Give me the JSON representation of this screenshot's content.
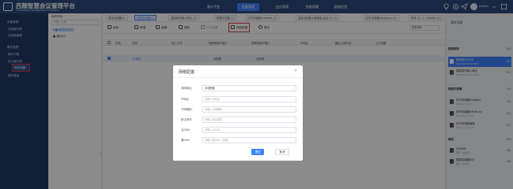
{
  "header": {
    "title": "西精智慧会议管理平台",
    "subtitle": "Co-Meeting Management Platform",
    "nav": [
      "演示平台",
      "设备管理",
      "会议管理",
      "智能屏幕",
      "基础信息"
    ],
    "active_nav": "设备管理",
    "user": "admin"
  },
  "sidebar": {
    "items": [
      {
        "label": "设备管理",
        "type": "group"
      },
      {
        "label": "控制器列表",
        "type": "item"
      },
      {
        "label": "控制器编辑",
        "type": "item"
      },
      {
        "label": "硬件管理",
        "type": "group"
      },
      {
        "label": "硬件列表",
        "type": "item"
      },
      {
        "label": "显示器列表",
        "type": "item"
      },
      {
        "label": "网关设备",
        "type": "item",
        "highlight": true
      },
      {
        "label": "硬件激活",
        "type": "item"
      }
    ]
  },
  "tree": {
    "label": "组织机构:",
    "search_placeholder": "请输入名称",
    "nodes": [
      {
        "label": "▾ ■ 测试平台(1)",
        "selected": true
      },
      {
        "label": "  ■ 演示(0)",
        "selected": false
      }
    ],
    "collapse_icon": "«"
  },
  "tabs": [
    {
      "label": "智慧控制器(1)",
      "active": false
    },
    {
      "label": "智慧控制器(0)",
      "active": true
    },
    {
      "label": "智能网关输入单元 (1)",
      "active": false
    },
    {
      "label": "数据中控器 (1)",
      "active": false
    },
    {
      "label": "红外传感器(Zigbee) (1)",
      "active": false
    },
    {
      "label": "智能控制器水晶面板(自定义) (1)",
      "active": false
    },
    {
      "label": "红外传感器(Modbus) (0)",
      "active": false
    },
    {
      "label": "网关 (0)",
      "active": false
    },
    {
      "label": "大4WAY (0)",
      "active": false
    },
    {
      "label": "智能控制器NVT (0)",
      "active": false
    }
  ],
  "toolbar": {
    "buttons": [
      {
        "label": "刷新",
        "disabled": false
      },
      {
        "label": "新增",
        "disabled": false
      },
      {
        "label": "编辑",
        "disabled": false
      },
      {
        "label": "删除",
        "disabled": false
      },
      {
        "label": "设计配置",
        "disabled": true
      },
      {
        "label": "网络配置",
        "disabled": false
      },
      {
        "label": "更多",
        "disabled": false
      }
    ],
    "filter_label": "搜索筛选"
  },
  "grid": {
    "columns": [
      "状态",
      "名称",
      "接入方式",
      "物联网络IP端口",
      "物联网络IP端口",
      "IP地址",
      "最后上线时间",
      "上行设备"
    ],
    "rows": [
      {
        "status": "",
        "name": "5G网关",
        "access": "",
        "port1": "未配置",
        "port2": "未配置",
        "ip": "",
        "last_online": "",
        "upstream": ""
      }
    ]
  },
  "modal": {
    "title": "网络配置",
    "close_icon": "×",
    "fields": [
      {
        "label": "网络地址:",
        "value": "手动配置",
        "placeholder": "",
        "select": true
      },
      {
        "label": "IP地址:",
        "value": "",
        "placeholder": "请输入IP地址",
        "select": false
      },
      {
        "label": "子网掩码:",
        "value": "",
        "placeholder": "请输入子网掩码",
        "select": false
      },
      {
        "label": "默认网关:",
        "value": "",
        "placeholder": "请输入默认网关",
        "select": false
      },
      {
        "label": "主DNS:",
        "value": "",
        "placeholder": "请输入主DNS",
        "select": false
      },
      {
        "label": "备DNS:",
        "value": "",
        "placeholder": "请输入备DNS（选填）",
        "select": false
      }
    ],
    "ok_label": "提交",
    "cancel_label": "取消"
  },
  "right_panel": {
    "title": "网关列表",
    "groups": [
      {
        "label": "智能网关",
        "count": "0/1",
        "items": [
          {
            "title": "智能网关XYMI",
            "sub": "SN:XXXX-XXXX-0001",
            "count": "0/1",
            "selected": true
          },
          {
            "title": "智能网关输入单元",
            "sub": "SN:XXXX-XXXX-0002",
            "count": "0/1",
            "selected": false
          }
        ]
      },
      {
        "label": "数据中控器",
        "count": "1/1",
        "items": [
          {
            "title": "红外传感器(Zigbee)",
            "sub": "Zigbee | 0.01%",
            "count": "1/1",
            "selected": false
          },
          {
            "title": "红外传感器(Modbus)",
            "sub": "Modbus | 0.01%",
            "count": "0/1",
            "selected": false
          },
          {
            "title": "红外传感器面板",
            "sub": "Modbus | 0.01%",
            "count": "0/1",
            "selected": false
          }
        ]
      },
      {
        "label": "网关",
        "count": "0/0",
        "items": [
          {
            "title": "大4WAY",
            "sub": "网关 | 未激活",
            "count": "0/0",
            "selected": false
          },
          {
            "title": "智能控制器NVT",
            "sub": "网关 | 未激活",
            "count": "0/0",
            "selected": false
          }
        ]
      }
    ]
  },
  "colors": {
    "primary": "#3f83ff",
    "header": "#2a4a7c",
    "sidebar": "#233a63",
    "highlight": "#e53935"
  }
}
